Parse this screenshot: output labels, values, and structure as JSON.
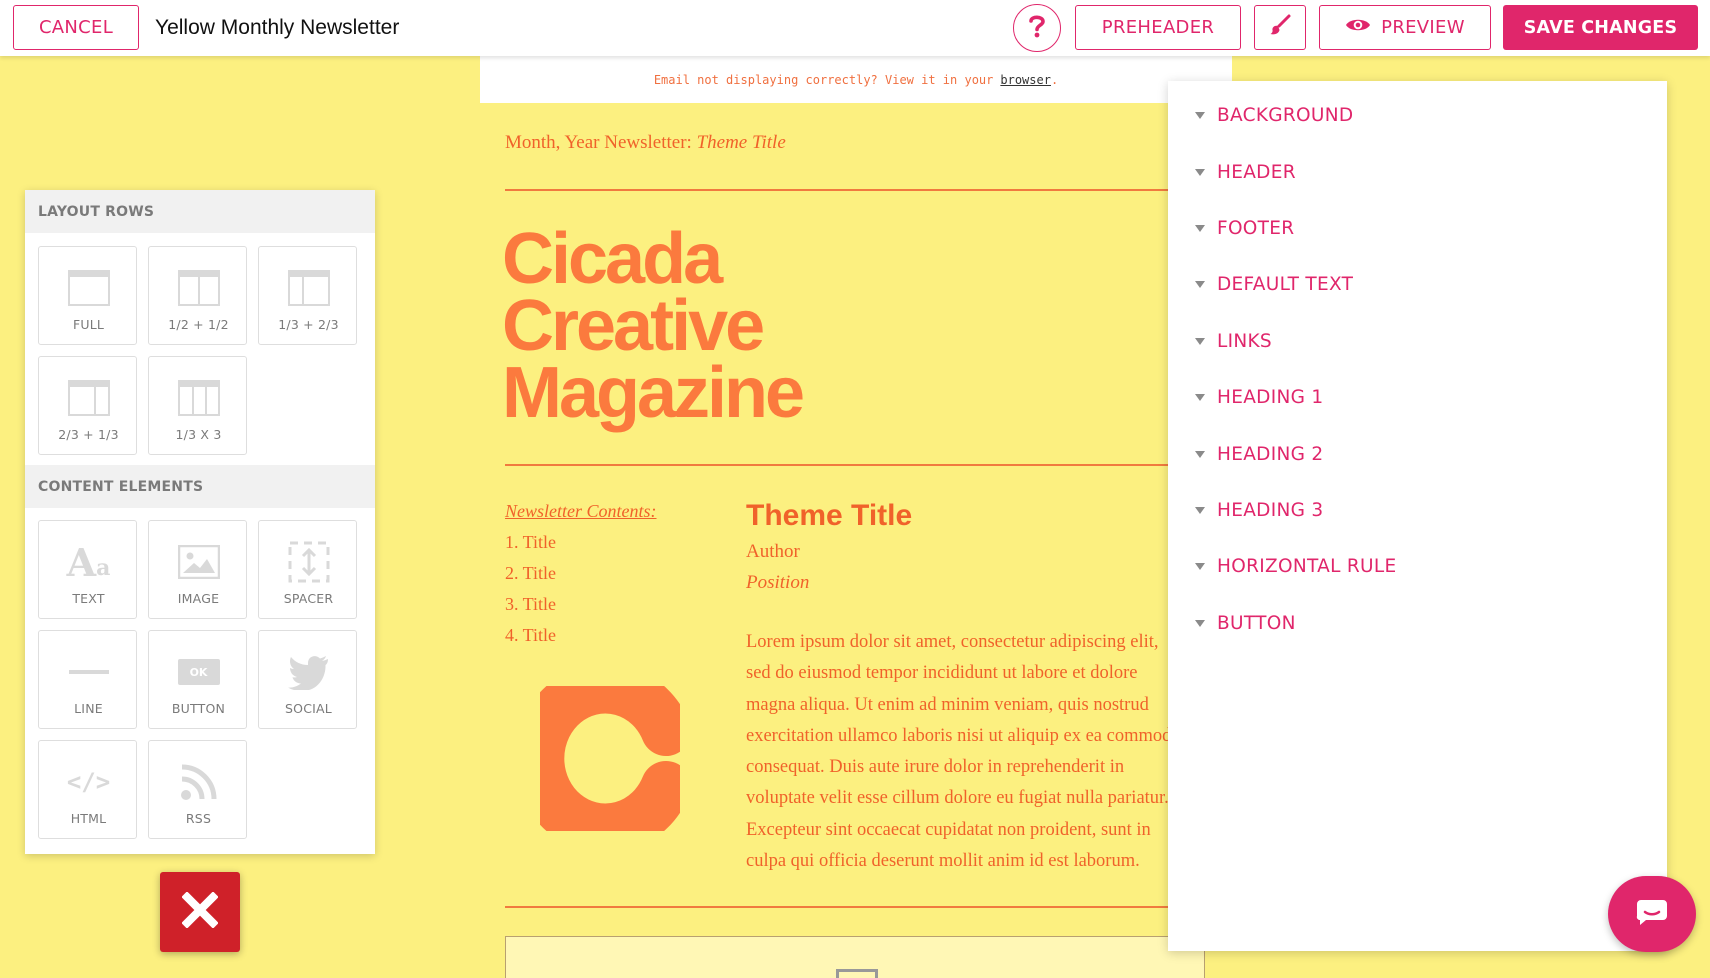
{
  "toolbar": {
    "cancel_label": "CANCEL",
    "document_title": "Yellow Monthly Newsletter",
    "help_icon": "question-icon",
    "preheader_label": "PREHEADER",
    "brush_icon": "paintbrush-icon",
    "preview_label": "PREVIEW",
    "preview_icon": "eye-icon",
    "save_label": "SAVE CHANGES"
  },
  "newsletter": {
    "top_notice": "Email not displaying correctly? View it in your",
    "top_notice_link": "browser",
    "top_notice_end": ".",
    "month_line": "Month, Year Newsletter: ",
    "month_line_theme": "Theme Title",
    "masthead_lines": [
      "Cicada",
      "Creative",
      "Magazine"
    ],
    "contents_title": "Newsletter Contents:",
    "contents_items": [
      "1. Title",
      "2. Title",
      "3. Title",
      "4. Title"
    ],
    "theme_title": "Theme Title",
    "author": "Author",
    "position": "Position",
    "body_lines": [
      "Lorem ipsum dolor sit amet, consectetur adipiscing elit,",
      "sed do eiusmod tempor incididunt ut labore et dolore",
      "magna aliqua. Ut enim ad minim veniam, quis nostrud",
      "exercitation ullamco laboris nisi ut aliquip ex ea commodo",
      "consequat. Duis aute irure dolor in reprehenderit in",
      "voluptate velit esse cillum dolore eu fugiat nulla pariatur.",
      "Excepteur sint occaecat cupidatat non proident, sunt in",
      "culpa qui officia deserunt mollit anim id est laborum."
    ],
    "accent_color": "#f0622a",
    "logo_color": "#fb7a3e"
  },
  "left_panel": {
    "layout_rows_header": "LAYOUT ROWS",
    "layout_rows": [
      {
        "label": "FULL",
        "icon": "layout-full-icon"
      },
      {
        "label": "1/2 + 1/2",
        "icon": "layout-half-half-icon"
      },
      {
        "label": "1/3 + 2/3",
        "icon": "layout-third-twothirds-icon"
      },
      {
        "label": "2/3 + 1/3",
        "icon": "layout-twothirds-third-icon"
      },
      {
        "label": "1/3 X 3",
        "icon": "layout-three-thirds-icon"
      }
    ],
    "content_elements_header": "CONTENT ELEMENTS",
    "content_elements": [
      {
        "label": "TEXT",
        "icon": "text-icon"
      },
      {
        "label": "IMAGE",
        "icon": "image-icon"
      },
      {
        "label": "SPACER",
        "icon": "spacer-icon"
      },
      {
        "label": "LINE",
        "icon": "line-icon"
      },
      {
        "label": "BUTTON",
        "icon": "button-icon",
        "icon_text": "OK"
      },
      {
        "label": "SOCIAL",
        "icon": "twitter-icon"
      },
      {
        "label": "HTML",
        "icon": "code-icon",
        "icon_text": "</>"
      },
      {
        "label": "RSS",
        "icon": "rss-icon"
      }
    ]
  },
  "style_panel": {
    "items": [
      "BACKGROUND",
      "HEADER",
      "FOOTER",
      "DEFAULT TEXT",
      "LINKS",
      "HEADING 1",
      "HEADING 2",
      "HEADING 3",
      "HORIZONTAL RULE",
      "BUTTON"
    ]
  },
  "colors": {
    "brand_pink": "#e0266b",
    "canvas_yellow": "#fcf080",
    "close_red": "#cf2129"
  }
}
